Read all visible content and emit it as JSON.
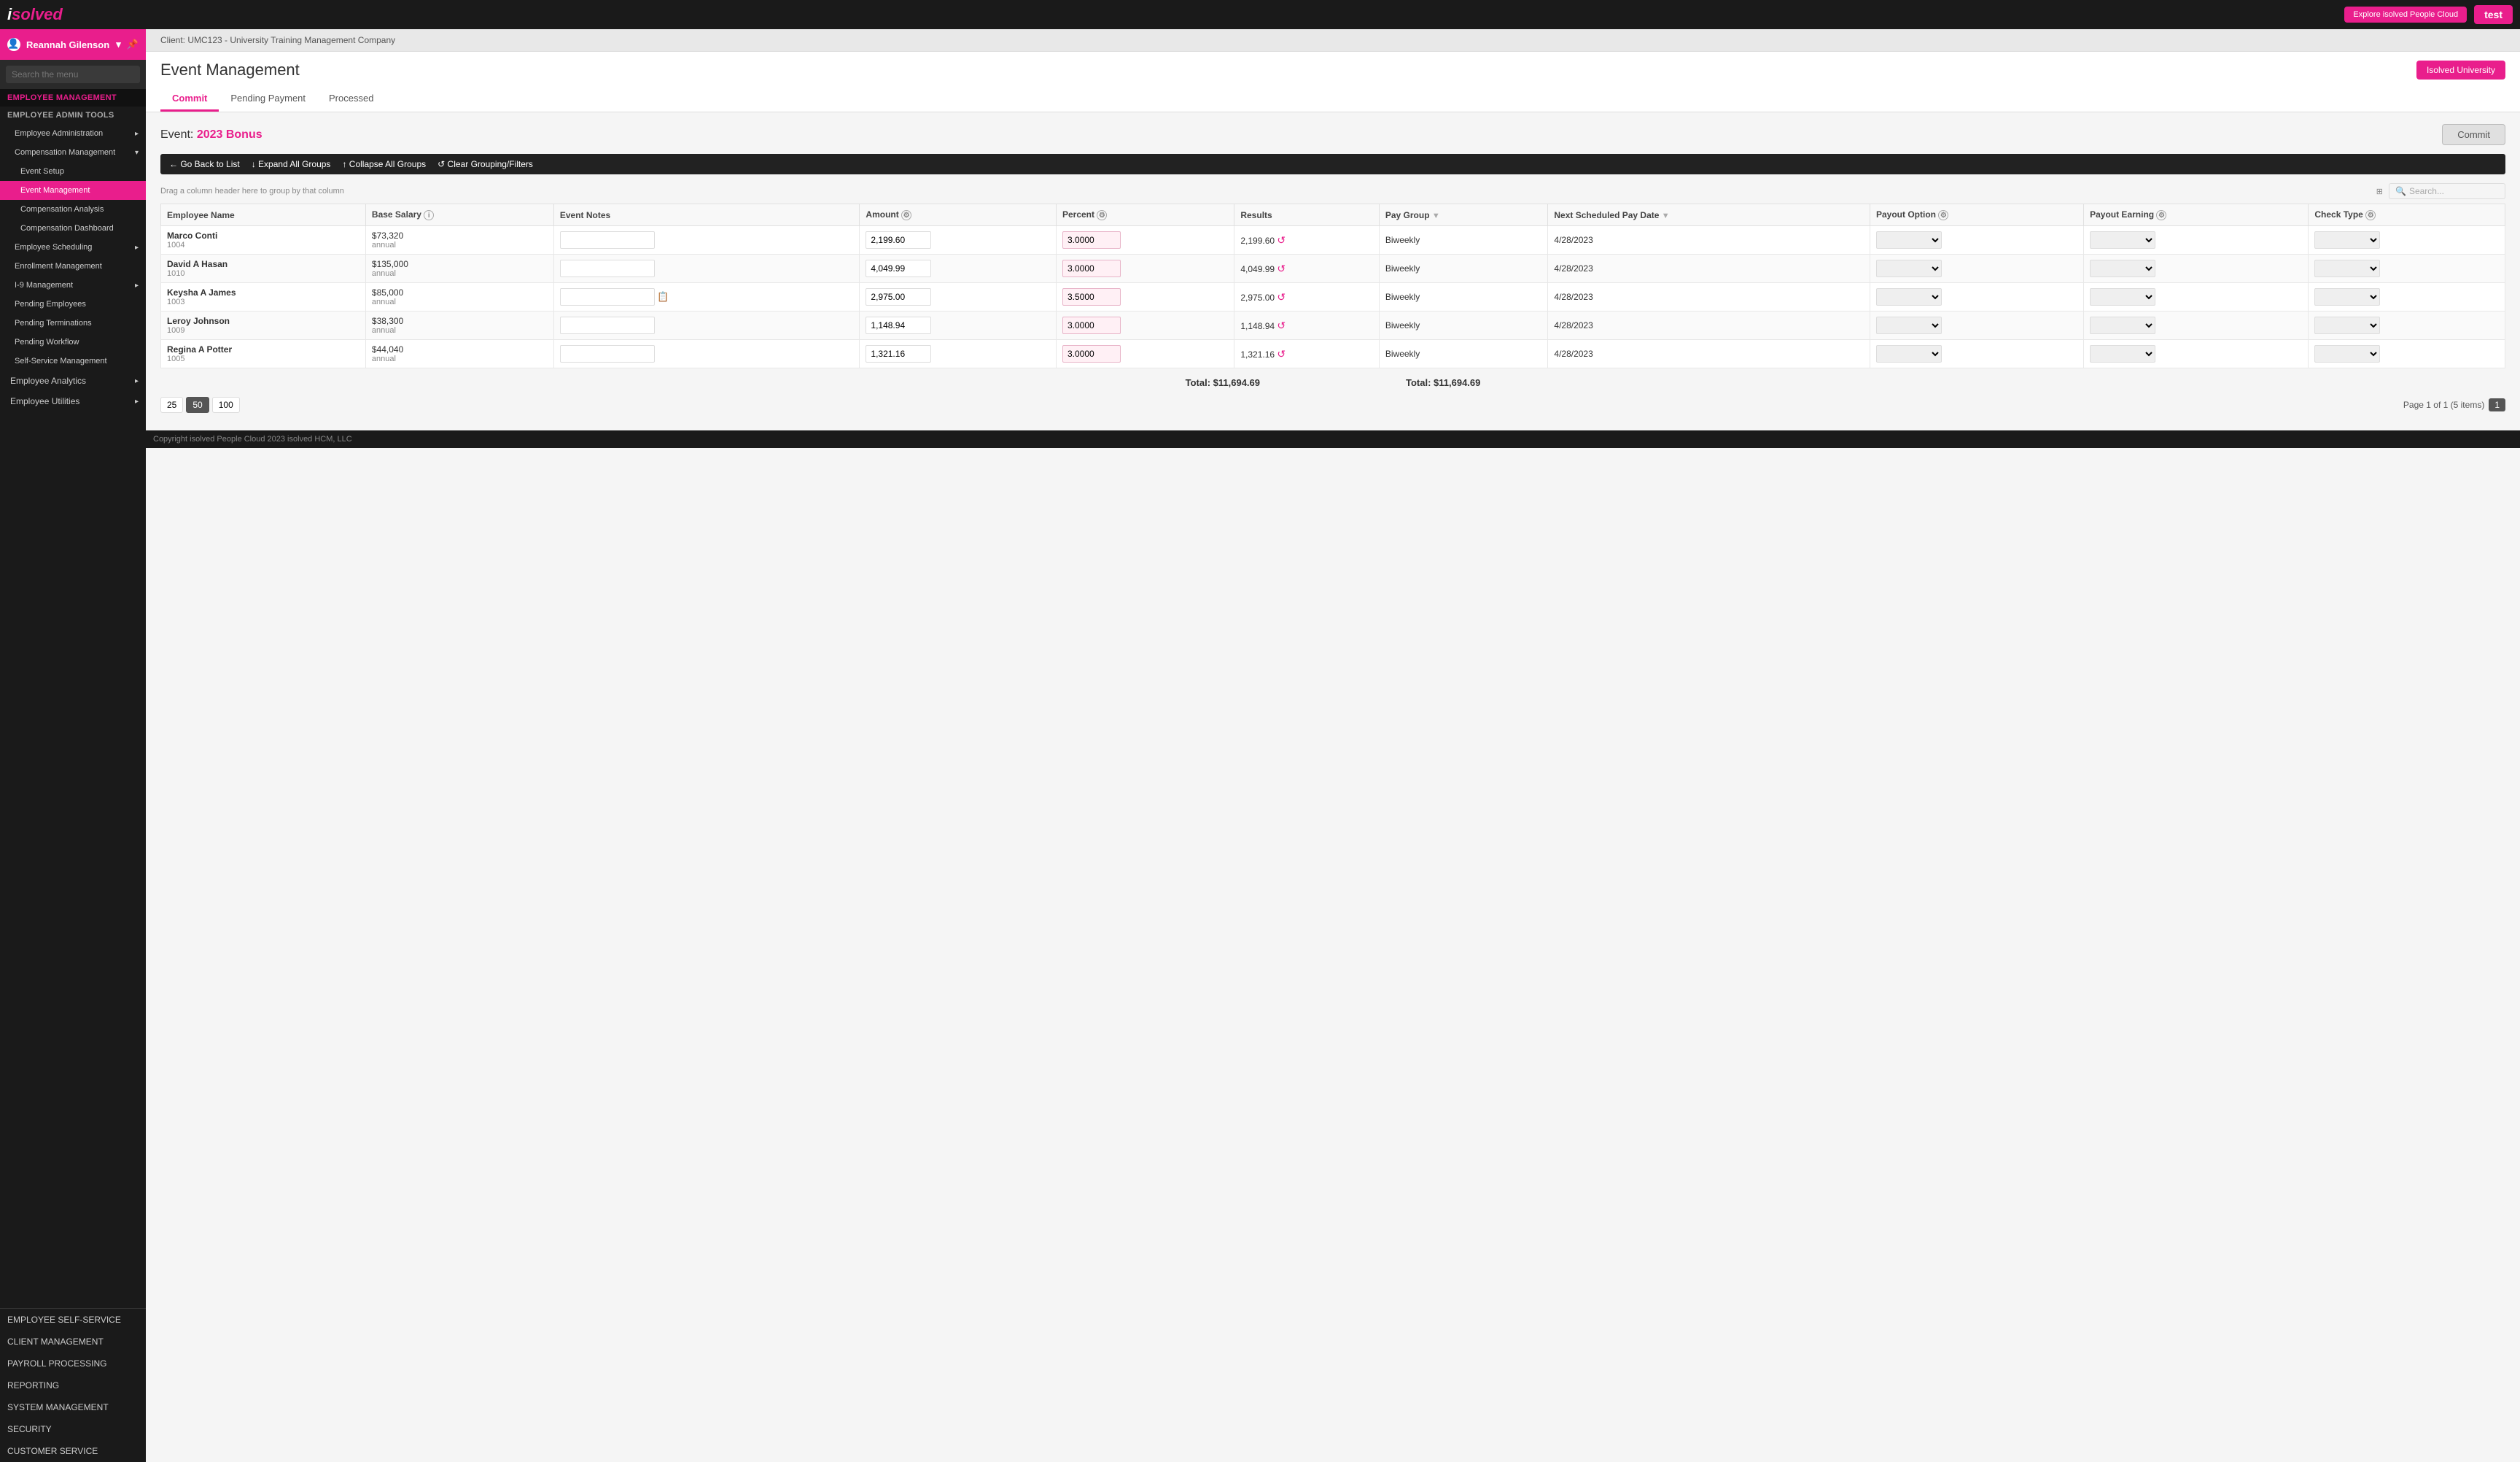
{
  "app": {
    "logo": "isolved",
    "top_explore_label": "Explore isolved People Cloud",
    "test_badge": "test"
  },
  "sidebar": {
    "user": {
      "name": "Reannah Gilenson",
      "icon": "user-icon"
    },
    "search_placeholder": "Search the menu",
    "sections": [
      {
        "id": "employee-management",
        "label": "EMPLOYEE MANAGEMENT",
        "type": "section-header"
      },
      {
        "id": "employee-admin-tools",
        "label": "EMPLOYEE ADMIN TOOLS",
        "type": "section-header-active"
      },
      {
        "id": "employee-admin",
        "label": "Employee Administration",
        "type": "item",
        "hasChevron": true
      },
      {
        "id": "compensation-mgmt",
        "label": "Compensation Management",
        "type": "sub",
        "hasChevron": true
      },
      {
        "id": "event-setup",
        "label": "Event Setup",
        "type": "sub2"
      },
      {
        "id": "event-management",
        "label": "Event Management",
        "type": "sub2",
        "active": true
      },
      {
        "id": "compensation-analysis",
        "label": "Compensation Analysis",
        "type": "sub2"
      },
      {
        "id": "compensation-dashboard",
        "label": "Compensation Dashboard",
        "type": "sub2"
      },
      {
        "id": "employee-scheduling",
        "label": "Employee Scheduling",
        "type": "sub",
        "hasChevron": true
      },
      {
        "id": "enrollment-management",
        "label": "Enrollment Management",
        "type": "sub"
      },
      {
        "id": "i9-management",
        "label": "I-9 Management",
        "type": "sub",
        "hasChevron": true
      },
      {
        "id": "pending-employees",
        "label": "Pending Employees",
        "type": "sub"
      },
      {
        "id": "pending-terminations",
        "label": "Pending Terminations",
        "type": "sub"
      },
      {
        "id": "pending-workflow",
        "label": "Pending Workflow",
        "type": "sub"
      },
      {
        "id": "self-service-mgmt",
        "label": "Self-Service Management",
        "type": "sub"
      },
      {
        "id": "employee-analytics",
        "label": "Employee Analytics",
        "type": "item",
        "hasChevron": true
      },
      {
        "id": "employee-utilities",
        "label": "Employee Utilities",
        "type": "item",
        "hasChevron": true
      }
    ],
    "bottom_items": [
      {
        "id": "employee-self-service",
        "label": "EMPLOYEE SELF-SERVICE"
      },
      {
        "id": "client-management",
        "label": "CLIENT MANAGEMENT"
      },
      {
        "id": "payroll-processing",
        "label": "PAYROLL PROCESSING"
      },
      {
        "id": "reporting",
        "label": "REPORTING"
      },
      {
        "id": "system-management",
        "label": "SYSTEM MANAGEMENT"
      },
      {
        "id": "security",
        "label": "SECURITY"
      },
      {
        "id": "customer-service",
        "label": "CUSTOMER SERVICE"
      }
    ]
  },
  "client_bar": {
    "text": "Client: UMC123 - University Training Management Company"
  },
  "page": {
    "title": "Event Management",
    "isolved_university_btn": "Isolved University",
    "tabs": [
      {
        "id": "commit",
        "label": "Commit",
        "active": true
      },
      {
        "id": "pending-payment",
        "label": "Pending Payment",
        "active": false
      },
      {
        "id": "processed",
        "label": "Processed",
        "active": false
      }
    ],
    "event_label": "Event:",
    "event_name": "2023 Bonus",
    "commit_btn": "Commit"
  },
  "toolbar": {
    "go_back": "← Go Back to List",
    "expand_all": "↓ Expand All Groups",
    "collapse_all": "↑ Collapse All Groups",
    "clear_grouping": "↺ Clear Grouping/Filters"
  },
  "drag_hint": "Drag a column header here to group by that column",
  "table": {
    "columns": [
      {
        "id": "employee-name",
        "label": "Employee Name"
      },
      {
        "id": "base-salary",
        "label": "Base Salary",
        "hasInfo": true
      },
      {
        "id": "event-notes",
        "label": "Event Notes"
      },
      {
        "id": "amount",
        "label": "Amount",
        "hasSettings": true
      },
      {
        "id": "percent",
        "label": "Percent",
        "hasSettings": true
      },
      {
        "id": "results",
        "label": "Results"
      },
      {
        "id": "pay-group",
        "label": "Pay Group",
        "hasFilter": true
      },
      {
        "id": "next-scheduled-pay-date",
        "label": "Next Scheduled Pay Date",
        "hasFilter": true
      },
      {
        "id": "payout-option",
        "label": "Payout Option",
        "hasSettings": true
      },
      {
        "id": "payout-earning",
        "label": "Payout Earning",
        "hasSettings": true
      },
      {
        "id": "check-type",
        "label": "Check Type",
        "hasSettings": true
      }
    ],
    "rows": [
      {
        "employee_name": "Marco Conti",
        "employee_id": "1004",
        "base_salary": "$73,320",
        "base_salary_type": "annual",
        "event_notes": "",
        "amount": "2,199.60",
        "percent": "3.0000",
        "results": "2,199.60",
        "pay_group": "Biweekly",
        "next_pay_date": "4/28/2023",
        "payout_option": "",
        "payout_earning": "",
        "check_type": "",
        "has_copy": false
      },
      {
        "employee_name": "David A Hasan",
        "employee_id": "1010",
        "base_salary": "$135,000",
        "base_salary_type": "annual",
        "event_notes": "",
        "amount": "4,049.99",
        "percent": "3.0000",
        "results": "4,049.99",
        "pay_group": "Biweekly",
        "next_pay_date": "4/28/2023",
        "payout_option": "",
        "payout_earning": "",
        "check_type": "",
        "has_copy": false
      },
      {
        "employee_name": "Keysha A James",
        "employee_id": "1003",
        "base_salary": "$85,000",
        "base_salary_type": "annual",
        "event_notes": "",
        "amount": "2,975.00",
        "percent": "3.5000",
        "results": "2,975.00",
        "pay_group": "Biweekly",
        "next_pay_date": "4/28/2023",
        "payout_option": "",
        "payout_earning": "",
        "check_type": "",
        "has_copy": true
      },
      {
        "employee_name": "Leroy Johnson",
        "employee_id": "1009",
        "base_salary": "$38,300",
        "base_salary_type": "annual",
        "event_notes": "",
        "amount": "1,148.94",
        "percent": "3.0000",
        "results": "1,148.94",
        "pay_group": "Biweekly",
        "next_pay_date": "4/28/2023",
        "payout_option": "",
        "payout_earning": "",
        "check_type": "",
        "has_copy": false
      },
      {
        "employee_name": "Regina A Potter",
        "employee_id": "1005",
        "base_salary": "$44,040",
        "base_salary_type": "annual",
        "event_notes": "",
        "amount": "1,321.16",
        "percent": "3.0000",
        "results": "1,321.16",
        "pay_group": "Biweekly",
        "next_pay_date": "4/28/2023",
        "payout_option": "",
        "payout_earning": "",
        "check_type": "",
        "has_copy": false
      }
    ],
    "total_amount": "Total: $11,694.69",
    "total_results": "Total: $11,694.69"
  },
  "pagination": {
    "page_sizes": [
      "25",
      "50",
      "100"
    ],
    "active_page_size": "50",
    "page_info": "Page 1 of 1 (5 items)",
    "current_page": "1"
  },
  "footer": {
    "copyright": "Copyright isolved People Cloud 2023 isolved HCM, LLC"
  }
}
